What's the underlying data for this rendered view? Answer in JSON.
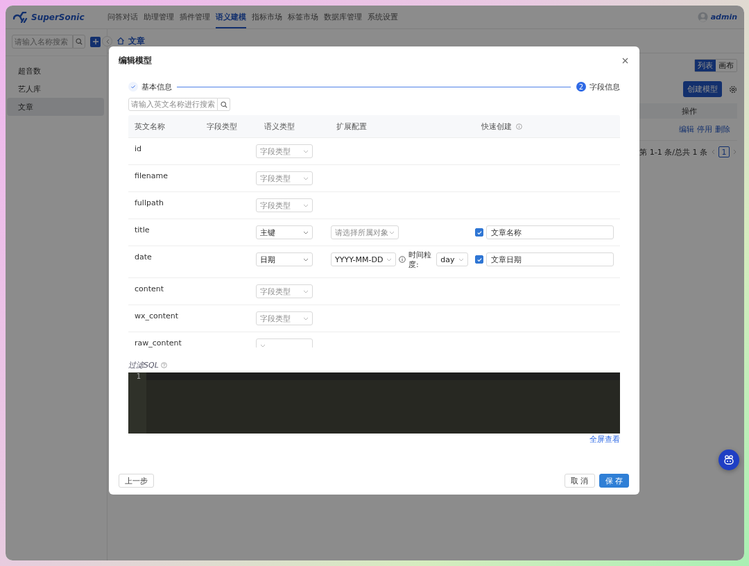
{
  "app": {
    "logo": "SuperSonic",
    "user": "admin",
    "nav": [
      {
        "label": "问答对话",
        "selected": false
      },
      {
        "label": "助理管理",
        "selected": false
      },
      {
        "label": "插件管理",
        "selected": false
      },
      {
        "label": "语义建模",
        "selected": true
      },
      {
        "label": "指标市场",
        "selected": false
      },
      {
        "label": "标签市场",
        "selected": false
      },
      {
        "label": "数据库管理",
        "selected": false
      },
      {
        "label": "系统设置",
        "selected": false
      }
    ]
  },
  "sidebar": {
    "search_placeholder": "请输入名称搜索",
    "items": [
      {
        "label": "超音数",
        "selected": false
      },
      {
        "label": "艺人库",
        "selected": false
      },
      {
        "label": "文章",
        "selected": true
      }
    ]
  },
  "breadcrumb": "文章",
  "page": {
    "view_toggle": [
      {
        "label": "列表",
        "selected": true
      },
      {
        "label": "画布",
        "selected": false
      }
    ],
    "create_button": "创建模型",
    "table_header": "操作",
    "actions": [
      "编辑",
      "停用",
      "删除"
    ],
    "pagination": {
      "summary": "第 1-1 条/总共 1 条",
      "pages": [
        {
          "label": "1",
          "selected": true
        }
      ]
    }
  },
  "modal": {
    "title": "编辑模型",
    "steps": [
      {
        "label": "基本信息",
        "completed": true
      },
      {
        "label": "字段信息",
        "completed": false,
        "number": "2"
      }
    ],
    "search_placeholder": "请输入英文名称进行搜索",
    "columns": [
      "英文名称",
      "字段类型",
      "语义类型",
      "扩展配置",
      "快速创建"
    ],
    "rows": [
      {
        "name": "id",
        "semantic": {
          "text": "字段类型",
          "placeholder": true
        }
      },
      {
        "name": "filename",
        "semantic": {
          "text": "字段类型",
          "placeholder": true
        }
      },
      {
        "name": "fullpath",
        "semantic": {
          "text": "字段类型",
          "placeholder": true
        }
      },
      {
        "name": "title",
        "semantic": {
          "text": "主键",
          "placeholder": false
        },
        "ext": {
          "kind": "object_select",
          "placeholder": "请选择所属对象"
        },
        "quick": {
          "checked": true,
          "value": "文章名称"
        }
      },
      {
        "name": "date",
        "semantic": {
          "text": "日期",
          "placeholder": false
        },
        "ext": {
          "kind": "date_format",
          "format": "YYYY-MM-DD",
          "granularity_label": "时间粒度:",
          "granularity": "day"
        },
        "quick": {
          "checked": true,
          "value": "文章日期"
        }
      },
      {
        "name": "content",
        "semantic": {
          "text": "字段类型",
          "placeholder": true
        }
      },
      {
        "name": "wx_content",
        "semantic": {
          "text": "字段类型",
          "placeholder": true
        }
      },
      {
        "name": "raw_content",
        "semantic": {
          "placeholder": true
        }
      }
    ],
    "filter_sql": {
      "label": "过滤SQL",
      "line_numbers": [
        "1"
      ],
      "fullscreen_link": "全屏查看"
    },
    "buttons": {
      "prev": "上一步",
      "cancel": "取 消",
      "save": "保 存"
    }
  }
}
